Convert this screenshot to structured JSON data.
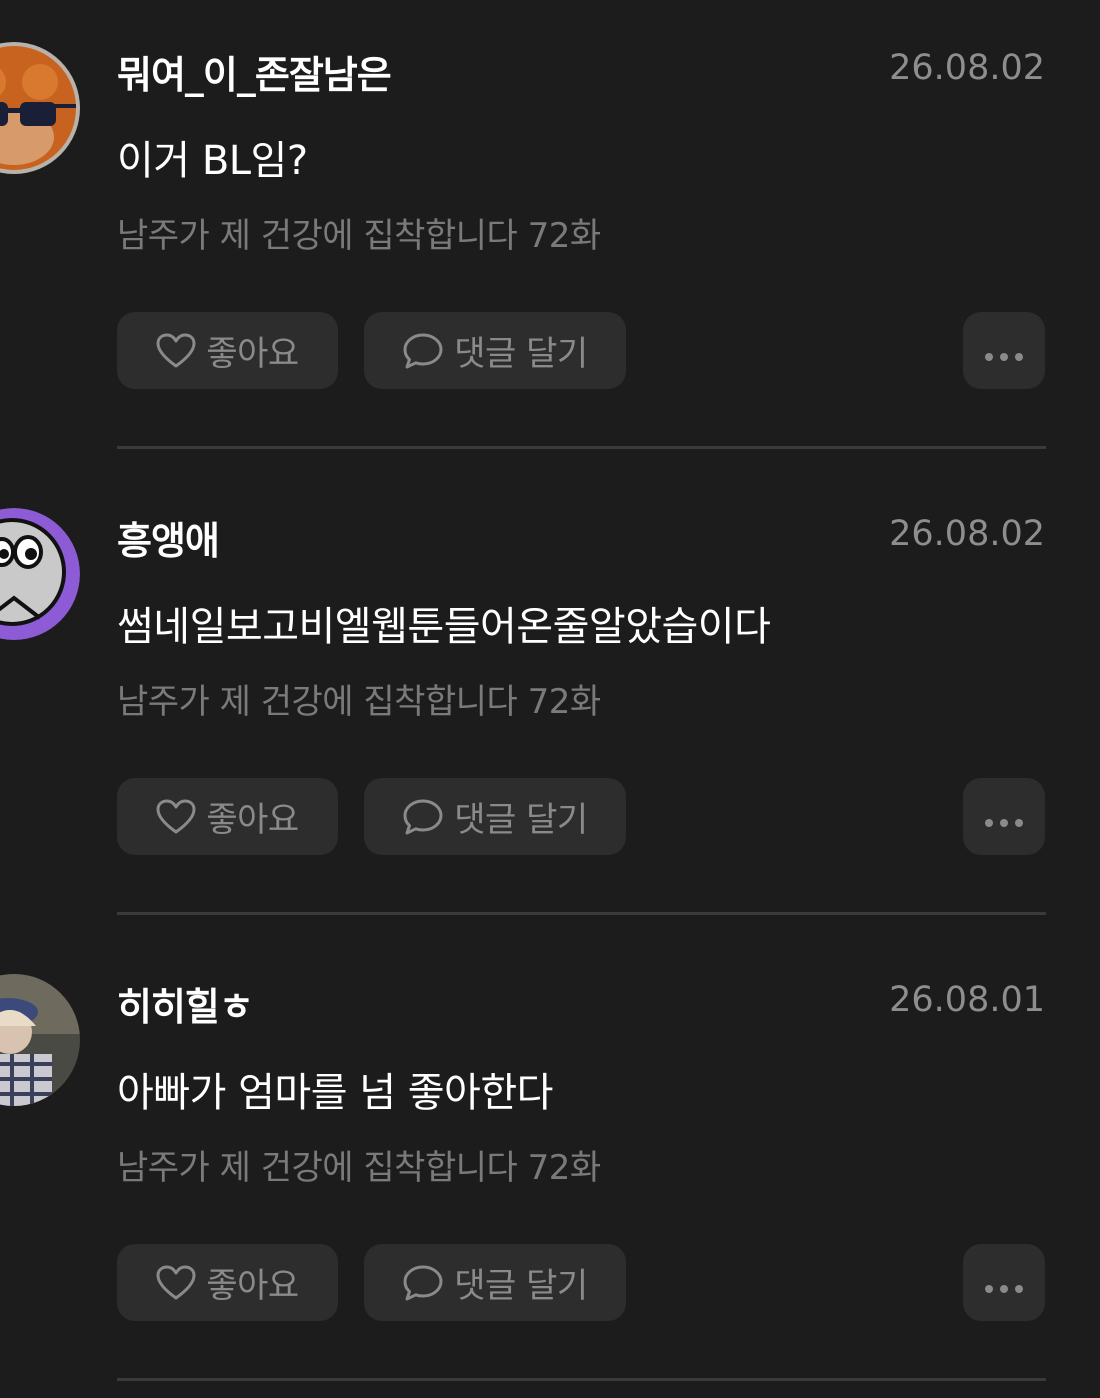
{
  "comments": [
    {
      "username": "뭐여_이_존잘남은",
      "date": "26.08.02",
      "text": "이거 BL임?",
      "episode": "남주가 제 건강에 집착합니다 72화",
      "like_label": "좋아요",
      "reply_label": "댓글 달기",
      "avatar_icon": "orangutan-sunglasses-avatar"
    },
    {
      "username": "흥앵애",
      "date": "26.08.02",
      "text": "썸네일보고비엘웹툰들어온줄알았습이다",
      "episode": "남주가 제 건강에 집착합니다 72화",
      "like_label": "좋아요",
      "reply_label": "댓글 달기",
      "avatar_icon": "cartoon-face-avatar"
    },
    {
      "username": "히히힐ㅎ",
      "date": "26.08.01",
      "text": "아빠가 엄마를 넘 좋아한다",
      "episode": "남주가 제 건강에 집착합니다 72화",
      "like_label": "좋아요",
      "reply_label": "댓글 달기",
      "avatar_icon": "person-photo-avatar"
    }
  ],
  "colors": {
    "background": "#1c1c1c",
    "button_bg": "#2d2d2d",
    "muted_text": "#8a8a8a",
    "divider": "#3a3a3a"
  }
}
